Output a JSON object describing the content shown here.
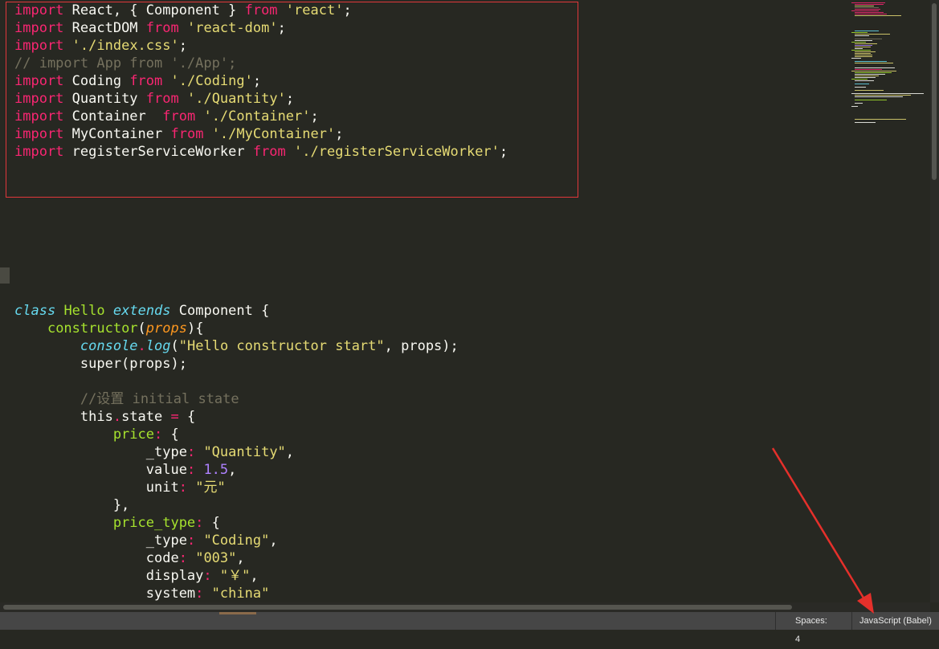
{
  "code_lines": {
    "l1": [
      "import",
      " React, { Component } ",
      "from",
      " ",
      "'react'",
      ";"
    ],
    "l2": [
      "import",
      " ReactDOM ",
      "from",
      " ",
      "'react-dom'",
      ";"
    ],
    "l3": [
      "import",
      " ",
      "'./index.css'",
      ";"
    ],
    "l4": "// import App from './App';",
    "l5": [
      "import",
      " Coding ",
      "from",
      " ",
      "'./Coding'",
      ";"
    ],
    "l6": [
      "import",
      " Quantity ",
      "from",
      " ",
      "'./Quantity'",
      ";"
    ],
    "l7": [
      "import",
      " Container  ",
      "from",
      " ",
      "'./Container'",
      ";"
    ],
    "l8": [
      "import",
      " MyContainer ",
      "from",
      " ",
      "'./MyContainer'",
      ";"
    ],
    "l9": [
      "import",
      " registerServiceWorker ",
      "from",
      " ",
      "'./registerServiceWorker'",
      ";"
    ],
    "l10": [
      "class",
      " ",
      "Hello",
      " ",
      "extends",
      " Component {"
    ],
    "l11": [
      "    ",
      "constructor",
      "(",
      "props",
      "){"
    ],
    "l12": [
      "        ",
      "console",
      ".",
      "log",
      "(",
      "\"Hello constructor start\"",
      ", props);"
    ],
    "l13": "        super(props);",
    "l14": "        //设置 initial state",
    "l15": [
      "        this",
      ".",
      "state ",
      "=",
      " {"
    ],
    "l16": [
      "            price",
      ":",
      " {"
    ],
    "l17": [
      "                _type",
      ":",
      " ",
      "\"Quantity\"",
      ","
    ],
    "l18": [
      "                value",
      ":",
      " ",
      "1.5",
      ","
    ],
    "l19": [
      "                unit",
      ":",
      " ",
      "\"元\""
    ],
    "l20": "            },",
    "l21": [
      "            price_type",
      ":",
      " {"
    ],
    "l22": [
      "                _type",
      ":",
      " ",
      "\"Coding\"",
      ","
    ],
    "l23": [
      "                code",
      ":",
      " ",
      "\"003\"",
      ","
    ],
    "l24": [
      "                display",
      ":",
      " ",
      "\"￥\"",
      ","
    ],
    "l25": [
      "                system",
      ":",
      " ",
      "\"china\""
    ]
  },
  "status_bar": {
    "spaces": "Spaces: 4",
    "syntax": "JavaScript (Babel)"
  },
  "annotation_colors": {
    "highlight_box": "#e0373b",
    "arrow": "#e5302b"
  }
}
